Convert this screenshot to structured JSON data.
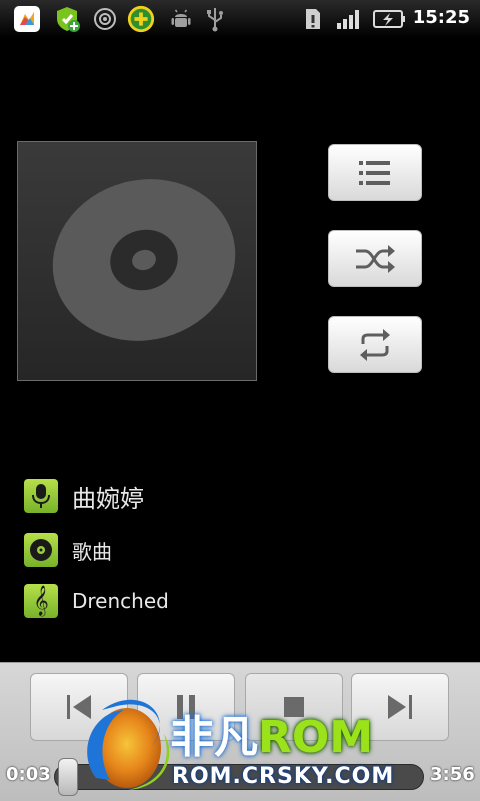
{
  "status_bar": {
    "time": "15:25",
    "icons": [
      "app-icon",
      "shield-plus-icon",
      "target-icon",
      "plus-badge-icon",
      "android-icon",
      "usb-icon",
      "sd-card-icon",
      "signal-icon",
      "battery-charging-icon"
    ]
  },
  "side_buttons": [
    {
      "name": "playlist-button",
      "icon": "list-icon"
    },
    {
      "name": "shuffle-button",
      "icon": "shuffle-icon"
    },
    {
      "name": "repeat-button",
      "icon": "repeat-icon"
    }
  ],
  "track": {
    "artist": "曲婉婷",
    "album": "歌曲",
    "title": "Drenched"
  },
  "controls": {
    "current_time": "0:03",
    "total_time": "3:56",
    "progress_percent": 1.3
  },
  "watermark": {
    "brand": "非凡",
    "rom": "ROM",
    "url": "ROM.CRSKY.COM"
  },
  "colors": {
    "accent_green": "#8cc63f",
    "watermark_blue": "#1b6fd6"
  }
}
